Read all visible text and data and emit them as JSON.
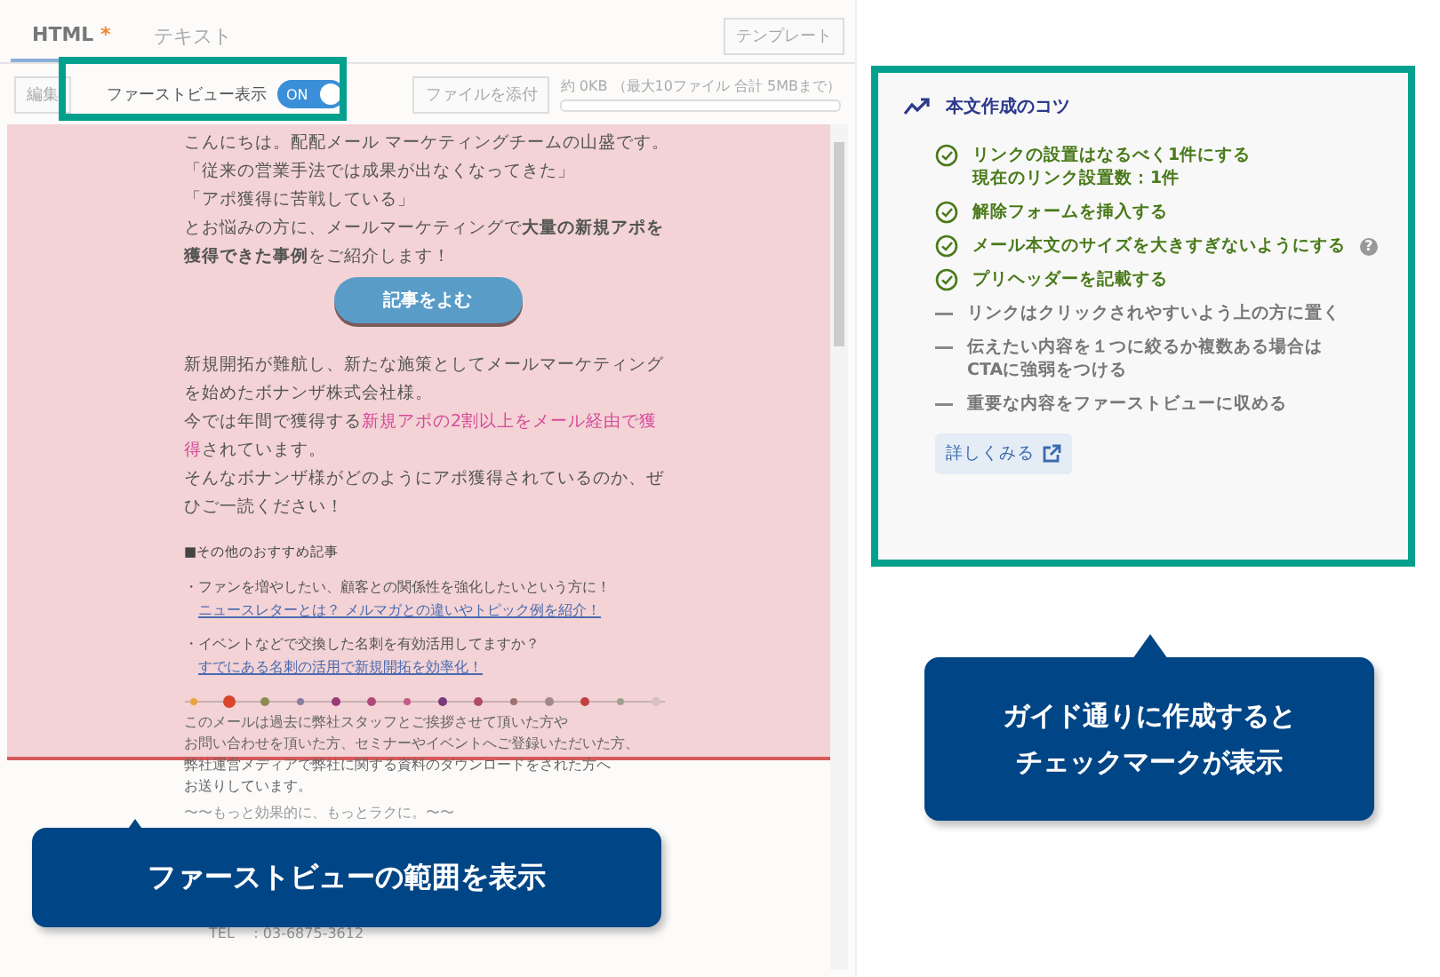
{
  "editor": {
    "tabs": [
      {
        "label": "HTML",
        "badge": "*",
        "selected": true
      },
      {
        "label": "テキスト",
        "selected": false
      }
    ],
    "template_button": "テンプレート",
    "toolbar": {
      "edit_button": "編集",
      "first_view_label": "ファーストビュー表示",
      "first_view_toggle": {
        "on": true,
        "label": "ON"
      },
      "attach_button": "ファイルを添付",
      "size_info": "約 0KB （最大10ファイル 合計 5MBまで）"
    },
    "email": {
      "paragraphs": [
        "こんにちは。配配メール マーケティングチームの山盛です。",
        "「従来の営業手法では成果が出なくなってきた」",
        "「アポ獲得に苦戦している」",
        "とお悩みの方に、メールマーケティングで**大量の新規アポを獲得できた事例**をご紹介します！"
      ],
      "cta_button": "記事をよむ",
      "story": [
        {
          "text": "新規開拓が難航し、新たな施策としてメールマーケティングを始めたボナンザ株式会社様。"
        },
        {
          "text": "今では年間で獲得する",
          "highlight": "新規アポの2割以上をメール経由で獲得",
          "after": "されています。"
        },
        {
          "text": "そんなボナンザ様がどのようにアポ獲得されているのか、ぜひご一読ください！"
        }
      ],
      "recommend_heading": "■その他のおすすめ記事",
      "recommendations": [
        {
          "text": "・ファンを増やしたい、顧客との関係性を強化したいという方に！",
          "link": "ニュースレターとは？ メルマガとの違いやトピック例を紹介！"
        },
        {
          "text": "・イベントなどで交換した名刺を有効活用してますか？",
          "link": "すでにある名刺の活用で新規開拓を効率化！"
        }
      ],
      "footer_lines": [
        "このメールは過去に弊社スタッフとご挨拶させて頂いた方や",
        "お問い合わせを頂いた方、セミナーやイベントへご登録いただいた方、",
        "弊社運営メディアで弊社に関する資料のダウンロードをされた方へ",
        "お送りしています。"
      ],
      "tagline": "〜〜もっと効果的に、もっとラクに。〜〜",
      "contact": "TEL　：03-6875-3612"
    }
  },
  "guide": {
    "title": "本文作成のコツ",
    "items": [
      {
        "kind": "done",
        "lines": [
          "リンクの設置はなるべく1件にする",
          "現在のリンク設置数：1件"
        ]
      },
      {
        "kind": "done",
        "lines": [
          "解除フォームを挿入する"
        ]
      },
      {
        "kind": "done",
        "lines": [
          "メール本文のサイズを大きすぎないようにする"
        ],
        "help": "?"
      },
      {
        "kind": "done",
        "lines": [
          "プリヘッダーを記載する"
        ]
      },
      {
        "kind": "todo",
        "lines": [
          "リンクはクリックされやすいよう上の方に置く"
        ]
      },
      {
        "kind": "todo",
        "lines": [
          "伝えたい内容を１つに絞るか複数ある場合は",
          "CTAに強弱をつける"
        ]
      },
      {
        "kind": "todo",
        "lines": [
          "重要な内容をファーストビューに収める"
        ]
      }
    ],
    "more_button": "詳しくみる"
  },
  "callouts": [
    {
      "lines": [
        "ファーストビューの範囲を表示"
      ]
    },
    {
      "lines": [
        "ガイド通りに作成すると",
        "チェックマークが表示"
      ]
    }
  ]
}
